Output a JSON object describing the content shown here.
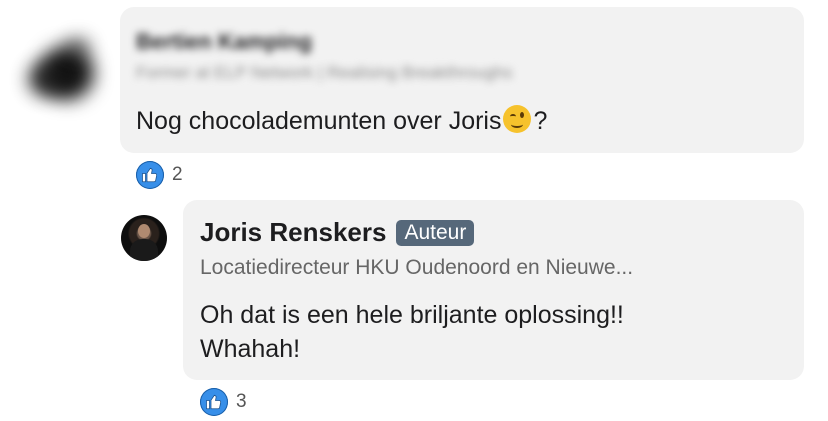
{
  "comment": {
    "author_name": "Bertien Kamping",
    "author_headline": "Former at ELP Network | Realising Breakthroughs",
    "text": "Nog chocolademunten over Joris",
    "text_suffix": "?",
    "emoji": "winking-face-emoji",
    "reaction_count": "2"
  },
  "reply": {
    "author_name": "Joris Renskers",
    "author_badge": "Auteur",
    "author_headline": "Locatiedirecteur HKU Oudenoord en Nieuwe...",
    "text_line1": "Oh dat is een hele briljante oplossing!!",
    "text_line2": "Whahah!",
    "reaction_count": "3"
  },
  "icons": {
    "reaction": "like-icon"
  },
  "colors": {
    "like": "#378fe9",
    "badge": "#56687a",
    "bubble": "#f2f2f2"
  }
}
